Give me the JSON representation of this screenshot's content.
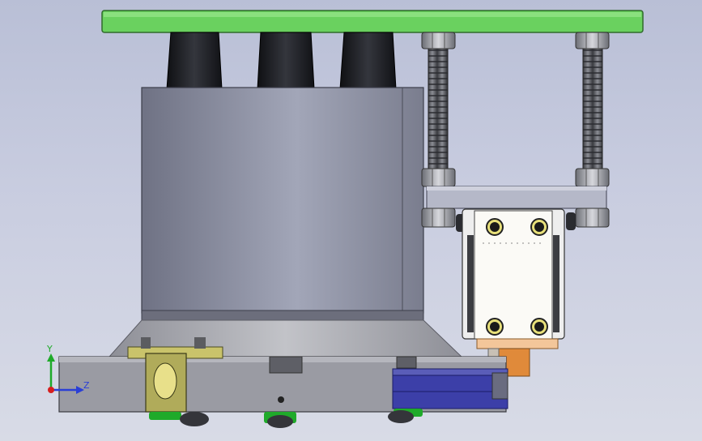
{
  "viewport": {
    "background_top": "#b9bfd6",
    "background_bottom": "#d8dbe6"
  },
  "triad": {
    "y_label": "Y",
    "z_label": "Z",
    "y_color": "#1faa2a",
    "z_color": "#2a3fd6",
    "origin_color": "#d61f1f"
  },
  "model": {
    "plate_color": "#6ad15f",
    "cylinder_color": "#8f92a3",
    "cap_color": "#1e1f24",
    "base_color": "#9a9ba3",
    "bracket_color": "#b0ab5a",
    "block_color": "#3c3fa8",
    "copper_color": "#e08a3a",
    "wheel_green": "#1faa2a"
  }
}
